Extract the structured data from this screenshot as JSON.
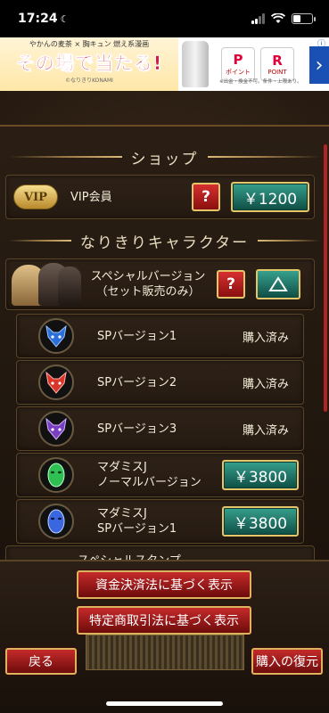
{
  "status_bar": {
    "time": "17:24"
  },
  "ad": {
    "small_text": "やかんの麦茶 × 胸キュン 燃え系漫画",
    "headline": "その場で当たる!",
    "tiny_text": "©なりきりKONAMI",
    "point_label": "ポイント",
    "rpoint": "POINT",
    "note": "※出金・換金不可。条件・上限あり。",
    "info": "ⓘ"
  },
  "shop": {
    "section_title": "ショップ",
    "vip": {
      "badge": "VIP",
      "label": "VIP会員",
      "help": "?",
      "price": "￥1200"
    }
  },
  "characters": {
    "section_title": "なりきりキャラクター",
    "special": {
      "label_line1": "スペシャルバージョン",
      "label_line2": "（セット販売のみ）",
      "help": "?"
    },
    "items": [
      {
        "label": "SPバージョン1",
        "status": "購入済み",
        "color": "#2d6fd8"
      },
      {
        "label": "SPバージョン2",
        "status": "購入済み",
        "color": "#d8362b"
      },
      {
        "label": "SPバージョン3",
        "status": "購入済み",
        "color": "#7a3fc0"
      }
    ],
    "madamis_normal": {
      "line1": "マダミスJ",
      "line2": "ノーマルバージョン",
      "price": "￥3800",
      "color": "#2fbf52"
    },
    "madamis_sp1": {
      "line1": "マダミスJ",
      "line2": "SPバージョン1",
      "price": "￥3800",
      "color": "#3a67e0"
    },
    "partial": {
      "label": "スペシャルスタンプ"
    }
  },
  "footer": {
    "fund_settlement": "資金決済法に基づく表示",
    "commercial_transactions": "特定商取引法に基づく表示",
    "back": "戻る",
    "restore": "購入の復元"
  }
}
